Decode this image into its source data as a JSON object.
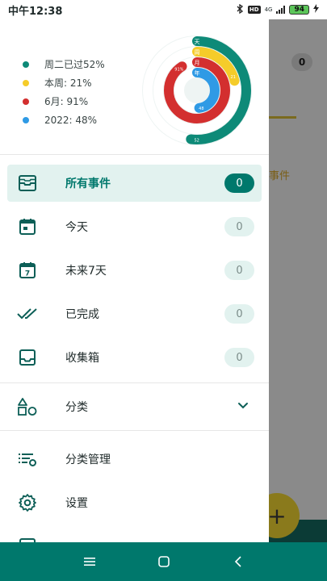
{
  "status": {
    "time": "中午12:38",
    "hd": "HD",
    "network": "4G",
    "battery": "94"
  },
  "background": {
    "count": "0",
    "text": "事件"
  },
  "legend": [
    {
      "label": "周二已过52%",
      "color": "#0e8a78"
    },
    {
      "label": "本周: 21%",
      "color": "#f5cc2a"
    },
    {
      "label": "6月: 91%",
      "color": "#d32f2f"
    },
    {
      "label": "2022: 48%",
      "color": "#2f9ae5"
    }
  ],
  "rings": {
    "day": {
      "value": 0.52,
      "label_top": "天",
      "label_end": "52"
    },
    "week": {
      "value": 0.21,
      "label_top": "周",
      "label_end": "21"
    },
    "month": {
      "value": 0.91,
      "label_top": "月",
      "label_end": "91%"
    },
    "year": {
      "value": 0.48,
      "label_top": "年",
      "label_end": "48"
    }
  },
  "menu": [
    {
      "label": "所有事件",
      "count": "0",
      "icon": "inbox-stack-icon",
      "active": true
    },
    {
      "label": "今天",
      "count": "0",
      "icon": "calendar-today-icon"
    },
    {
      "label": "未来7天",
      "count": "0",
      "icon": "calendar-seven-icon"
    },
    {
      "label": "已完成",
      "count": "0",
      "icon": "double-check-icon"
    },
    {
      "label": "收集箱",
      "count": "0",
      "icon": "tray-icon"
    }
  ],
  "categories": {
    "label": "分类",
    "icon": "shapes-icon",
    "chevron": "chevron-down-icon"
  },
  "tools": [
    {
      "label": "分类管理",
      "icon": "list-settings-icon"
    },
    {
      "label": "设置",
      "icon": "gear-icon"
    }
  ],
  "colors": {
    "accent": "#00786c",
    "accent_light": "#e2f2ef",
    "nav": "#00786c"
  }
}
